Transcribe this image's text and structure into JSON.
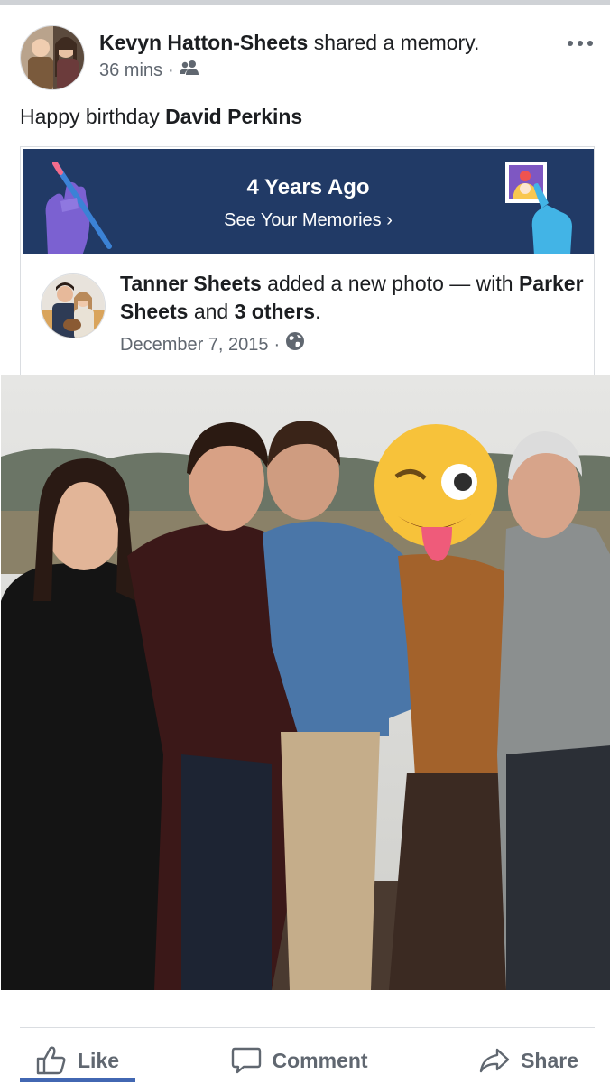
{
  "post": {
    "author_name": "Kevyn Hatton-Sheets",
    "action": " shared a memory.",
    "time": "36 mins",
    "separator": "·",
    "audience_icon": "friends-icon",
    "text_prefix": "Happy birthday ",
    "text_tag": "David Perkins"
  },
  "memory": {
    "title": "4 Years Ago",
    "link": "See Your Memories ›",
    "banner_color": "#213a66"
  },
  "shared": {
    "author": "Tanner Sheets",
    "action": " added a new photo — with ",
    "tagged": "Parker Sheets",
    "conjunction": " and ",
    "others": "3 others",
    "period": ".",
    "date": "December 7, 2015",
    "separator": "·",
    "audience_icon": "globe-icon"
  },
  "actions": {
    "like": "Like",
    "comment": "Comment",
    "share": "Share"
  },
  "colors": {
    "accent": "#4267b2",
    "secondary_text": "#606770"
  }
}
